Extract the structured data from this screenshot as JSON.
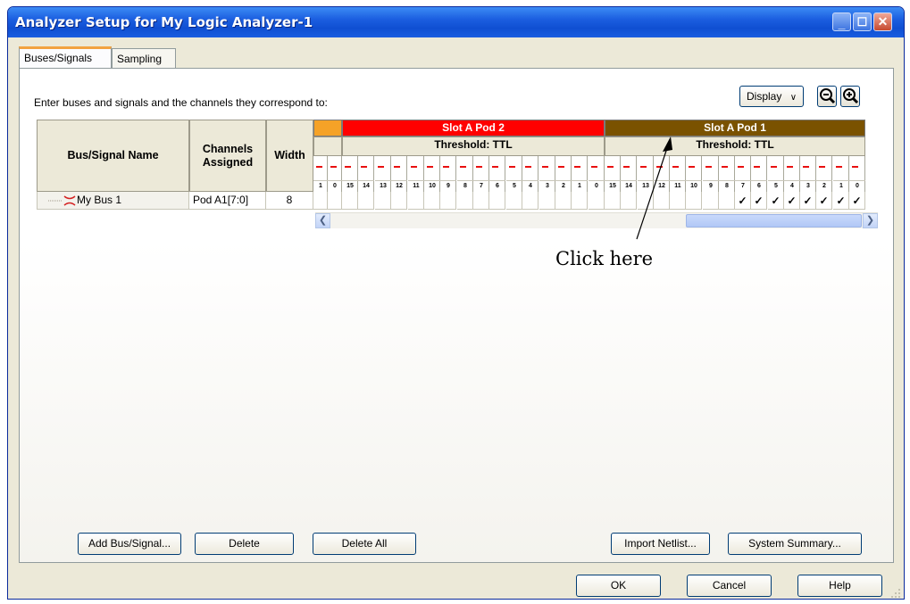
{
  "window": {
    "title": "Analyzer Setup for My Logic Analyzer-1"
  },
  "tabs": [
    {
      "label": "Buses/Signals",
      "active": true
    },
    {
      "label": "Sampling",
      "active": false
    }
  ],
  "instruction": "Enter buses and signals and the channels they correspond to:",
  "toolbar": {
    "display_label": "Display",
    "zoom_out_icon": "zoom-out-icon",
    "zoom_in_icon": "zoom-in-icon"
  },
  "grid": {
    "col_name": "Bus/Signal Name",
    "col_channels": "Channels Assigned",
    "col_width": "Width",
    "pods": [
      {
        "label": "",
        "color": "#f5a227"
      },
      {
        "label": "Slot A Pod 2",
        "color": "#ff0000"
      },
      {
        "label": "Slot A Pod 1",
        "color": "#7a5200"
      }
    ],
    "threshold_pod2": "Threshold: TTL",
    "threshold_pod1": "Threshold: TTL",
    "channels_extra": [
      "1",
      "0"
    ],
    "channels_pod2": [
      "15",
      "14",
      "13",
      "12",
      "11",
      "10",
      "9",
      "8",
      "7",
      "6",
      "5",
      "4",
      "3",
      "2",
      "1",
      "0"
    ],
    "channels_pod1": [
      "15",
      "14",
      "13",
      "12",
      "11",
      "10",
      "9",
      "8",
      "7",
      "6",
      "5",
      "4",
      "3",
      "2",
      "1",
      "0"
    ],
    "rows": [
      {
        "name": "My Bus 1",
        "channels": "Pod A1[7:0]",
        "width": "8",
        "pod1_checked": [
          false,
          false,
          false,
          false,
          false,
          false,
          false,
          false,
          true,
          true,
          true,
          true,
          true,
          true,
          true,
          true
        ]
      }
    ]
  },
  "check_mark": "✓",
  "buttons": {
    "add": "Add Bus/Signal...",
    "delete": "Delete",
    "delete_all": "Delete All",
    "import": "Import Netlist...",
    "summary": "System Summary...",
    "ok": "OK",
    "cancel": "Cancel",
    "help": "Help"
  },
  "annotation": "Click here"
}
